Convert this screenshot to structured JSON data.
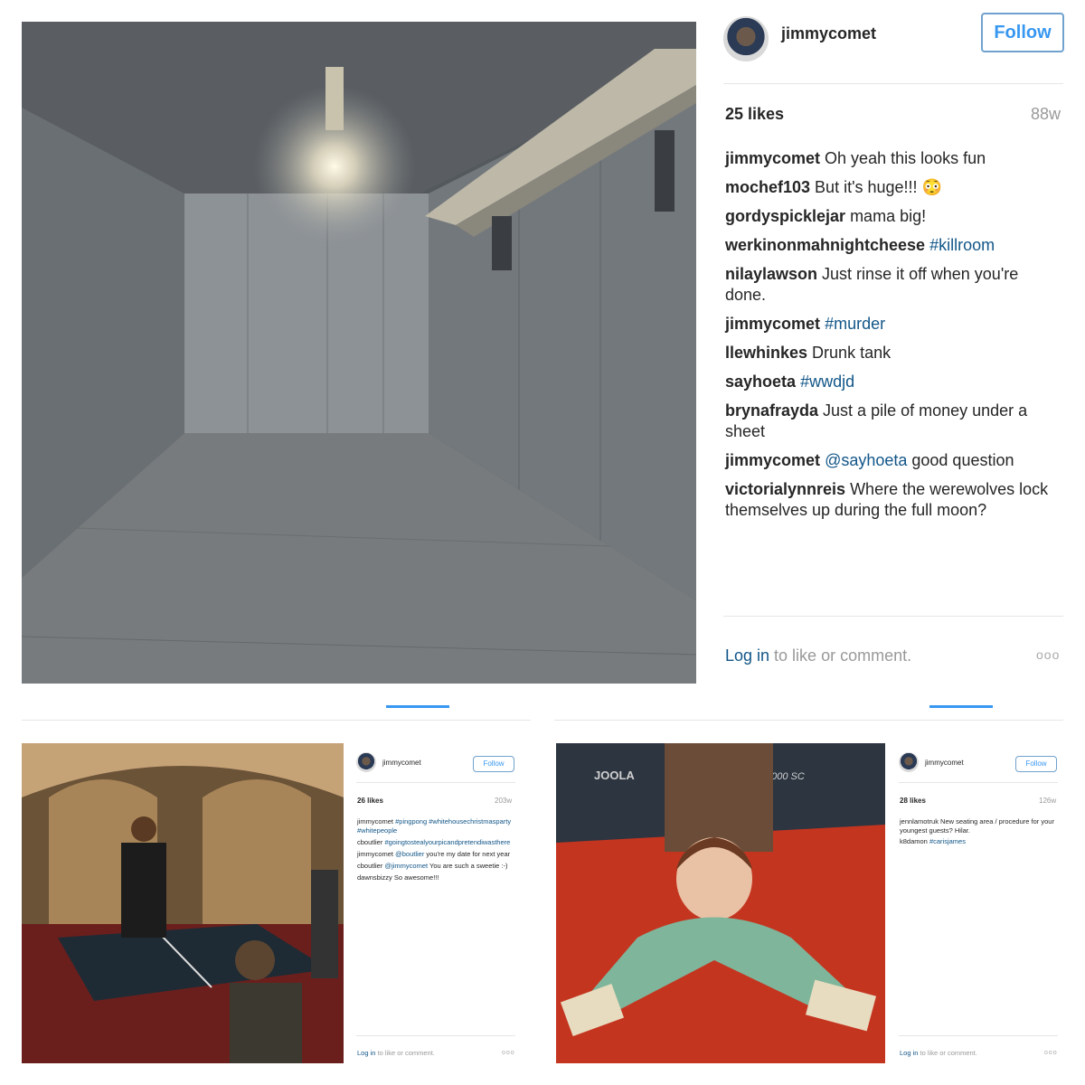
{
  "top_post": {
    "username": "jimmycomet",
    "follow_label": "Follow",
    "likes": "25 likes",
    "time_ago": "88w",
    "comments": [
      {
        "user": "jimmycomet",
        "text": " Oh yeah this looks fun",
        "tag": ""
      },
      {
        "user": "mochef103",
        "text": " But it's huge!!! 😳",
        "tag": ""
      },
      {
        "user": "gordyspicklejar",
        "text": " mama big!",
        "tag": ""
      },
      {
        "user": "werkinonmahnightcheese",
        "text": " ",
        "tag": "#killroom"
      },
      {
        "user": "nilaylawson",
        "text": " Just rinse it off when you're done.",
        "tag": ""
      },
      {
        "user": "jimmycomet",
        "text": " ",
        "tag": "#murder"
      },
      {
        "user": "llewhinkes",
        "text": " Drunk tank",
        "tag": ""
      },
      {
        "user": "sayhoeta",
        "text": " ",
        "tag": "#wwdjd"
      },
      {
        "user": "brynafrayda",
        "text": " Just a pile of money under a sheet",
        "tag": ""
      },
      {
        "user": "jimmycomet",
        "text": " ",
        "tag": "@sayhoeta",
        "after": " good question"
      },
      {
        "user": "victorialynnreis",
        "text": " Where the werewolves lock themselves up during the full moon?",
        "tag": ""
      }
    ],
    "login_link": "Log in",
    "login_rest": " to like or comment.",
    "more": "ooo"
  },
  "left_post": {
    "username": "jimmycomet",
    "follow_label": "Follow",
    "likes": "26 likes",
    "time_ago": "203w",
    "comments": [
      {
        "user": "jimmycomet",
        "tag": "#pingpong #whitehousechristmasparty #whitepeople",
        "text": ""
      },
      {
        "user": "cboutlier",
        "tag": "#goingtostealyourpicandpretendiwasthere",
        "text": ""
      },
      {
        "user": "jimmycomet",
        "tag": "@boutlier",
        "text": " you're my date for next year"
      },
      {
        "user": "cboutlier",
        "tag": "@jimmycomet",
        "text": " You are such a sweetie :-)"
      },
      {
        "user": "dawnsbizzy",
        "tag": "",
        "text": " So awesome!!!"
      }
    ],
    "login_link": "Log in",
    "login_rest": " to like or comment.",
    "more": "ooo"
  },
  "right_post": {
    "username": "jimmycomet",
    "follow_label": "Follow",
    "likes": "28 likes",
    "time_ago": "126w",
    "comments": [
      {
        "user": "jennlamotruk",
        "tag": "",
        "text": " New seating area / procedure for your youngest guests? Hilar."
      },
      {
        "user": "k8damon",
        "tag": "#carisjames",
        "text": ""
      }
    ],
    "login_link": "Log in",
    "login_rest": " to like or comment.",
    "more": "ooo"
  },
  "photo_text": {
    "table_brand": "JOOLA",
    "table_model": "3000 SC"
  },
  "colors": {
    "link": "#125688",
    "follow": "#3897f0",
    "muted": "#999999"
  }
}
